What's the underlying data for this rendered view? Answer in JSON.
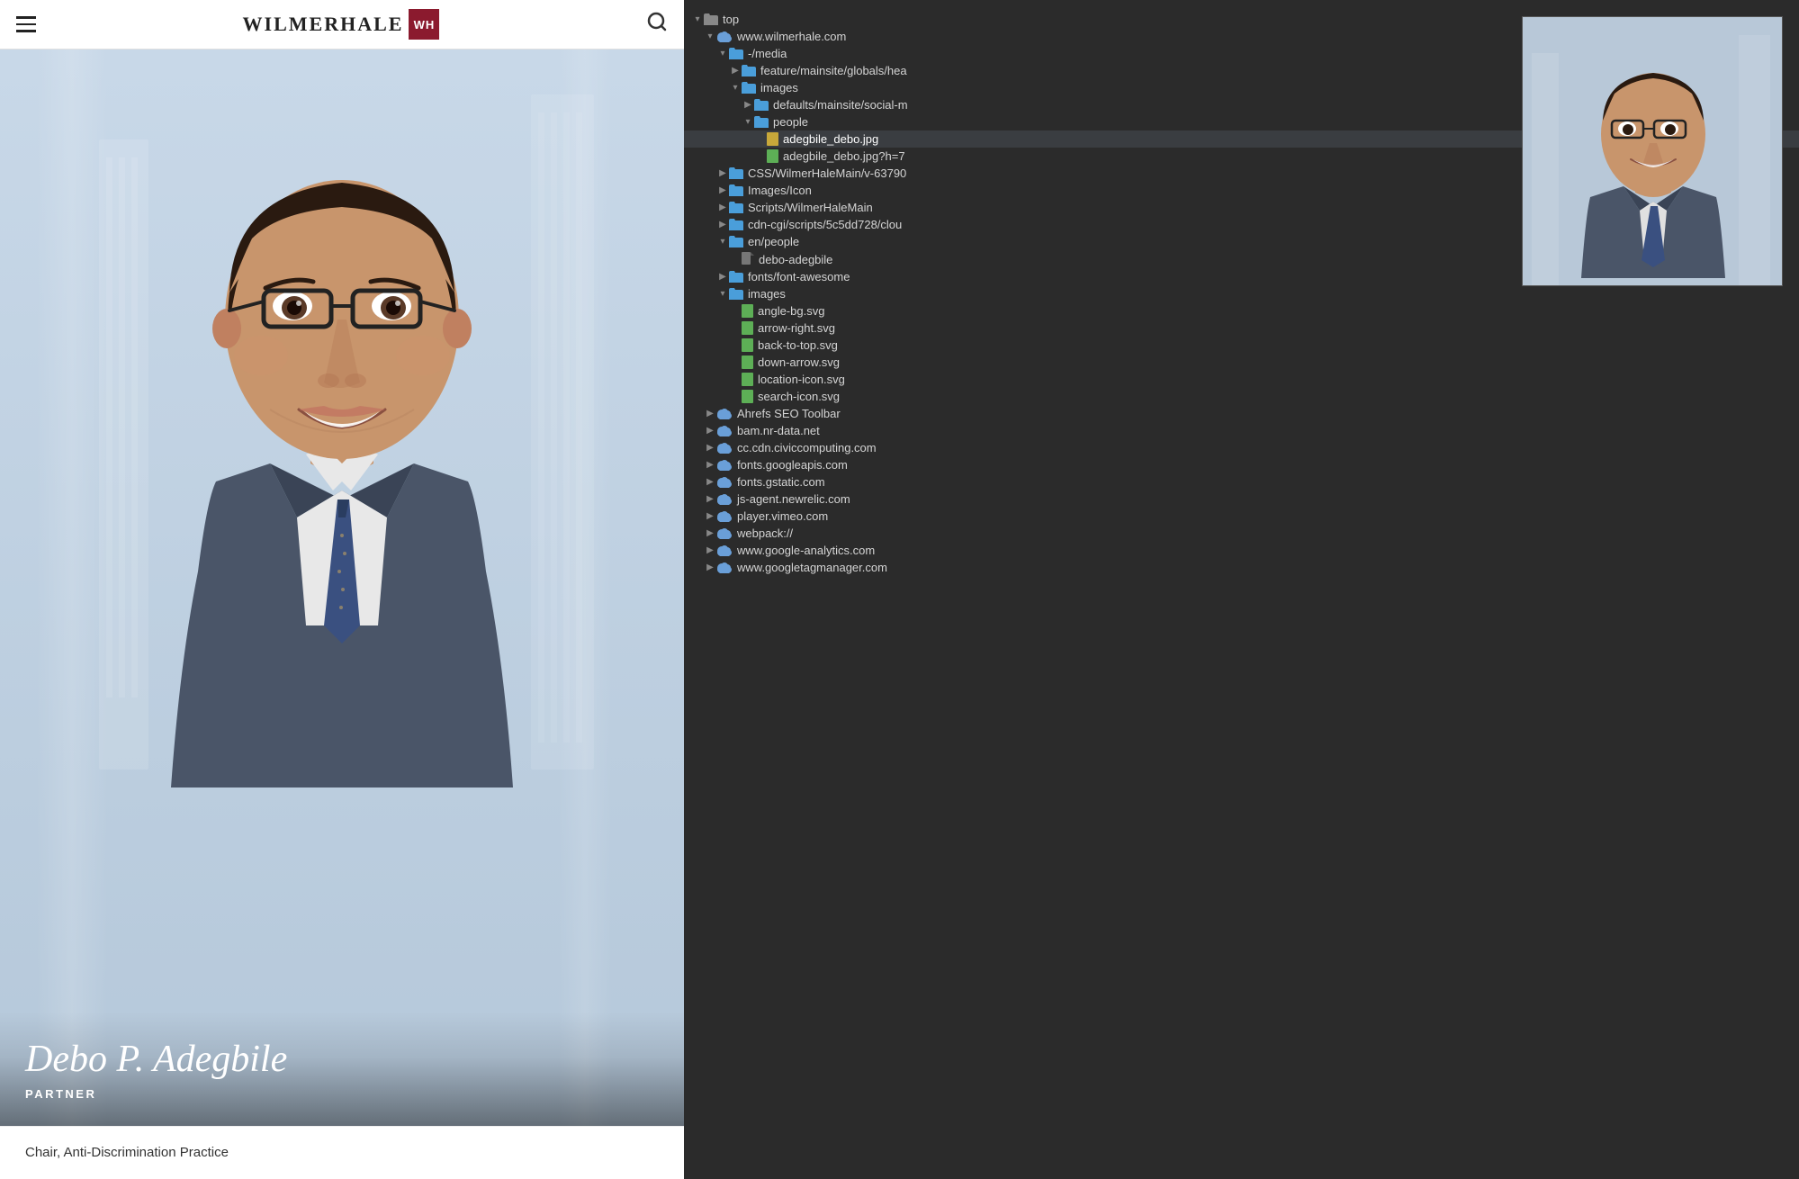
{
  "header": {
    "logo_text": "WILMERHALE",
    "logo_badge": "WH",
    "hamburger_label": "menu",
    "search_label": "search"
  },
  "hero": {
    "person_name": "Debo P. Adegbile",
    "person_title": "PARTNER",
    "sub_title": "Chair, Anti-Discrimination Practice"
  },
  "filetree": {
    "root_label": "top",
    "nodes": [
      {
        "id": "top",
        "label": "top",
        "type": "root-folder",
        "depth": 0,
        "expanded": true,
        "icon": "folder"
      },
      {
        "id": "www.wilmerhale.com",
        "label": "www.wilmerhale.com",
        "type": "cloud-folder",
        "depth": 1,
        "expanded": true,
        "icon": "cloud"
      },
      {
        "id": "media",
        "label": "-/media",
        "type": "folder",
        "depth": 2,
        "expanded": true,
        "icon": "folder-blue"
      },
      {
        "id": "feature",
        "label": "feature/mainsite/globals/hea",
        "type": "folder",
        "depth": 3,
        "expanded": false,
        "icon": "folder-blue"
      },
      {
        "id": "images",
        "label": "images",
        "type": "folder",
        "depth": 3,
        "expanded": true,
        "icon": "folder-blue"
      },
      {
        "id": "defaults",
        "label": "defaults/mainsite/social-m",
        "type": "folder",
        "depth": 4,
        "expanded": false,
        "icon": "folder-blue"
      },
      {
        "id": "people",
        "label": "people",
        "type": "folder",
        "depth": 4,
        "expanded": true,
        "icon": "folder-blue",
        "selected": false
      },
      {
        "id": "adegbile_debo_jpg",
        "label": "adegbile_debo.jpg",
        "type": "file-yellow",
        "depth": 5,
        "icon": "file-yellow",
        "selected": true
      },
      {
        "id": "adegbile_debo_jpg_h7",
        "label": "adegbile_debo.jpg?h=7",
        "type": "file-green",
        "depth": 5,
        "icon": "file-green"
      },
      {
        "id": "css_wilmerhalemain",
        "label": "CSS/WilmerHaleMain/v-63790",
        "type": "folder",
        "depth": 2,
        "expanded": false,
        "icon": "folder-blue"
      },
      {
        "id": "images_icon",
        "label": "Images/Icon",
        "type": "folder",
        "depth": 2,
        "expanded": false,
        "icon": "folder-blue"
      },
      {
        "id": "scripts_wilmerhalemain",
        "label": "Scripts/WilmerHaleMain",
        "type": "folder",
        "depth": 2,
        "expanded": false,
        "icon": "folder-blue"
      },
      {
        "id": "cdn_cgi",
        "label": "cdn-cgi/scripts/5c5dd728/clou",
        "type": "folder",
        "depth": 2,
        "expanded": false,
        "icon": "folder-blue"
      },
      {
        "id": "en_people",
        "label": "en/people",
        "type": "folder",
        "depth": 2,
        "expanded": true,
        "icon": "folder-blue"
      },
      {
        "id": "debo_adegbile",
        "label": "debo-adegbile",
        "type": "page",
        "depth": 3,
        "icon": "page"
      },
      {
        "id": "fonts_font_awesome",
        "label": "fonts/font-awesome",
        "type": "folder",
        "depth": 2,
        "expanded": false,
        "icon": "folder-blue"
      },
      {
        "id": "images2",
        "label": "images",
        "type": "folder",
        "depth": 2,
        "expanded": true,
        "icon": "folder-blue"
      },
      {
        "id": "angle_bg",
        "label": "angle-bg.svg",
        "type": "file-green",
        "depth": 3,
        "icon": "file-green"
      },
      {
        "id": "arrow_right",
        "label": "arrow-right.svg",
        "type": "file-green",
        "depth": 3,
        "icon": "file-green"
      },
      {
        "id": "back_to_top",
        "label": "back-to-top.svg",
        "type": "file-green",
        "depth": 3,
        "icon": "file-green"
      },
      {
        "id": "down_arrow",
        "label": "down-arrow.svg",
        "type": "file-green",
        "depth": 3,
        "icon": "file-green"
      },
      {
        "id": "location_icon",
        "label": "location-icon.svg",
        "type": "file-green",
        "depth": 3,
        "icon": "file-green"
      },
      {
        "id": "search_icon",
        "label": "search-icon.svg",
        "type": "file-green",
        "depth": 3,
        "icon": "file-green"
      },
      {
        "id": "ahrefs_seo",
        "label": "Ahrefs SEO Toolbar",
        "type": "cloud-folder",
        "depth": 1,
        "expanded": false,
        "icon": "cloud"
      },
      {
        "id": "bam_nr",
        "label": "bam.nr-data.net",
        "type": "cloud-folder",
        "depth": 1,
        "expanded": false,
        "icon": "cloud"
      },
      {
        "id": "cc_cdn",
        "label": "cc.cdn.civiccomputing.com",
        "type": "cloud-folder",
        "depth": 1,
        "expanded": false,
        "icon": "cloud"
      },
      {
        "id": "fonts_google",
        "label": "fonts.googleapis.com",
        "type": "cloud-folder",
        "depth": 1,
        "expanded": false,
        "icon": "cloud"
      },
      {
        "id": "fonts_gstatic",
        "label": "fonts.gstatic.com",
        "type": "cloud-folder",
        "depth": 1,
        "expanded": false,
        "icon": "cloud"
      },
      {
        "id": "js_agent",
        "label": "js-agent.newrelic.com",
        "type": "cloud-folder",
        "depth": 1,
        "expanded": false,
        "icon": "cloud"
      },
      {
        "id": "player_vimeo",
        "label": "player.vimeo.com",
        "type": "cloud-folder",
        "depth": 1,
        "expanded": false,
        "icon": "cloud"
      },
      {
        "id": "webpack",
        "label": "webpack://",
        "type": "cloud-folder",
        "depth": 1,
        "expanded": false,
        "icon": "cloud"
      },
      {
        "id": "www_google_analytics",
        "label": "www.google-analytics.com",
        "type": "cloud-folder",
        "depth": 1,
        "expanded": false,
        "icon": "cloud"
      },
      {
        "id": "www_googletagmanager",
        "label": "www.googletagmanager.com",
        "type": "cloud-folder",
        "depth": 1,
        "expanded": false,
        "icon": "cloud"
      }
    ]
  },
  "thumbnail": {
    "visible": true
  }
}
